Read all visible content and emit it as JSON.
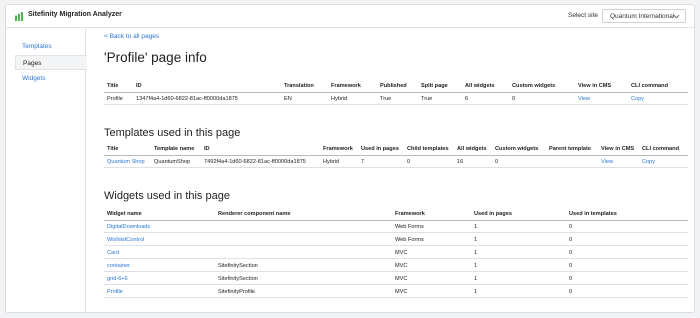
{
  "header": {
    "app_title": "Sitefinity Migration Analyzer",
    "select_site_label": "Select site",
    "selected_site": "Quantum International"
  },
  "sidebar": {
    "items": [
      {
        "label": "Templates"
      },
      {
        "label": "Pages"
      },
      {
        "label": "Widgets"
      }
    ]
  },
  "main": {
    "back_link": "< Back to all pages",
    "title": "'Profile' page info",
    "page_info": {
      "columns": [
        "Title",
        "ID",
        "Translation",
        "Framework",
        "Published",
        "Split page",
        "All widgets",
        "Custom widgets",
        "View in CMS",
        "CLI command"
      ],
      "row": [
        "Profile",
        "1347f4a4-1d60-6822-81ac-ff0000da1875",
        "EN",
        "Hybrid",
        "True",
        "True",
        "6",
        "0",
        "View",
        "Copy"
      ]
    },
    "templates_section": {
      "heading": "Templates used in this page",
      "columns": [
        "Title",
        "Template name",
        "ID",
        "Framework",
        "Used in pages",
        "Child templates",
        "All widgets",
        "Custom widgets",
        "Parent template",
        "View in CMS",
        "CLI command"
      ],
      "row": [
        "Quantum Shop",
        "QuantumShop",
        "7492f4a4-1d60-6822-81ac-ff0000da1875",
        "Hybrid",
        "7",
        "0",
        "16",
        "0",
        "",
        "View",
        "Copy"
      ]
    },
    "widgets_section": {
      "heading": "Widgets used in this page",
      "columns": [
        "Widget name",
        "Renderer component name",
        "Framework",
        "Used in pages",
        "Used in templates"
      ],
      "rows": [
        [
          "DigitalDownloads",
          "",
          "Web Forms",
          "1",
          "0"
        ],
        [
          "WishlistControl",
          "",
          "Web Forms",
          "1",
          "0"
        ],
        [
          "Card",
          "",
          "MVC",
          "1",
          "0"
        ],
        [
          "container",
          "SitefinitySection",
          "MVC",
          "1",
          "0"
        ],
        [
          "grid-6+6",
          "SitefinitySection",
          "MVC",
          "1",
          "0"
        ],
        [
          "Profile",
          "SitefinityProfile",
          "MVC",
          "1",
          "0"
        ]
      ]
    }
  },
  "colors": {
    "link": "#2b77d6",
    "logo_green": "#4caf50"
  },
  "icons": {
    "logo": "sitefinity-logo-icon",
    "select_chevron": "chevron-down-icon"
  }
}
